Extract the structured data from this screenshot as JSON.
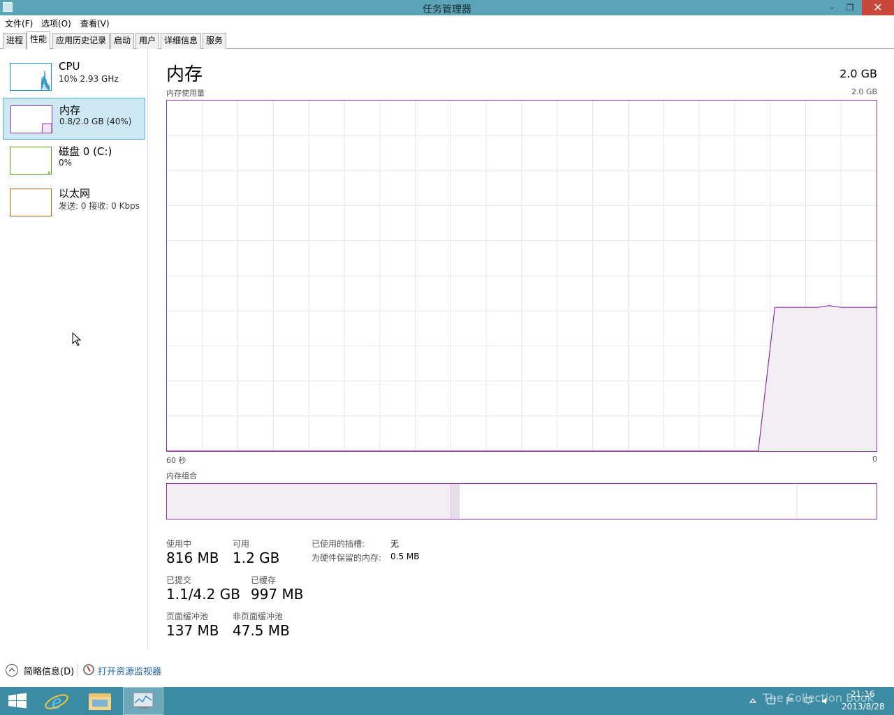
{
  "window": {
    "title": "任务管理器",
    "minimize": "–",
    "restore": "❐",
    "close": "✕"
  },
  "menu": [
    "文件(F)",
    "选项(O)",
    "查看(V)"
  ],
  "tabs": [
    "进程",
    "性能",
    "应用历史记录",
    "启动",
    "用户",
    "详细信息",
    "服务"
  ],
  "active_tab": "性能",
  "sidebar": {
    "items": [
      {
        "name": "CPU",
        "sub": "10% 2.93 GHz",
        "color": "#1c8cc3"
      },
      {
        "name": "内存",
        "sub": "0.8/2.0 GB (40%)",
        "color": "#8b2fa5"
      },
      {
        "name": "磁盘 0 (C:)",
        "sub": "0%",
        "color": "#4da61c"
      },
      {
        "name": "以太网",
        "sub": "发送: 0 接收: 0 Kbps",
        "color": "#a76514"
      }
    ]
  },
  "main": {
    "title": "内存",
    "capacity": "2.0 GB",
    "usage_label": "内存使用量",
    "usage_max": "2.0 GB",
    "axis_left": "60 秒",
    "axis_right": "0",
    "composition_label": "内存组合"
  },
  "chart_data": {
    "type": "area",
    "title": "内存使用量",
    "x_unit": "秒",
    "x_range": [
      60,
      0
    ],
    "ylim": [
      0,
      2.0
    ],
    "y_unit": "GB",
    "grid": true,
    "color": "#8b2fa5",
    "series": [
      {
        "x": [
          60,
          10,
          8.6,
          7,
          5,
          4,
          3,
          2,
          0
        ],
        "values": [
          0,
          0,
          0.82,
          0.82,
          0.82,
          0.83,
          0.82,
          0.82,
          0.82
        ]
      }
    ]
  },
  "composition": {
    "in_use_fraction": 0.4,
    "modified_fraction": 0.012,
    "standby_fraction": 0.476,
    "free_fraction": 0.112
  },
  "stats": {
    "in_use_label": "使用中",
    "in_use_value": "816 MB",
    "available_label": "可用",
    "available_value": "1.2 GB",
    "committed_label": "已提交",
    "committed_value": "1.1/4.2 GB",
    "cached_label": "已缓存",
    "cached_value": "997 MB",
    "paged_label": "页面缓冲池",
    "paged_value": "137 MB",
    "nonpaged_label": "非页面缓冲池",
    "nonpaged_value": "47.5 MB",
    "slots_label": "已使用的插槽:",
    "slots_value": "无",
    "reserved_label": "为硬件保留的内存:",
    "reserved_value": "0.5 MB"
  },
  "bottom": {
    "fewer_details": "简略信息(D)",
    "open_monitor": "打开资源监视器"
  },
  "taskbar": {
    "time": "21:16",
    "date": "2013/8/28",
    "watermark": "The Collection Book"
  }
}
